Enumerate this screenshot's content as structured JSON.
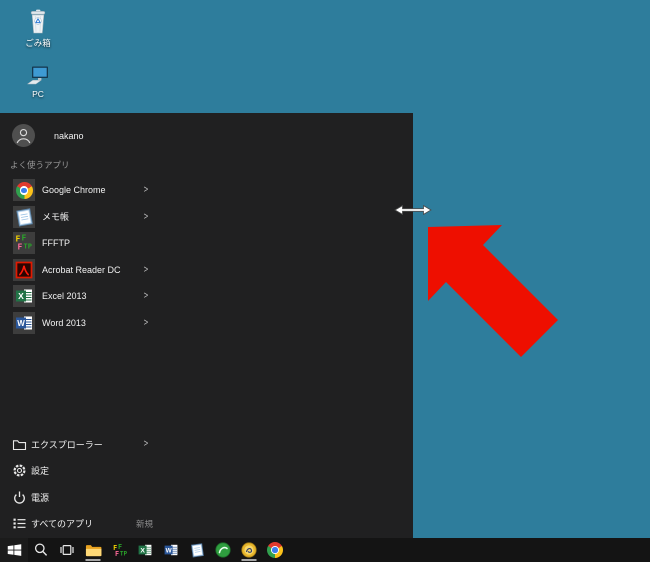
{
  "desktop": {
    "background_color": "#2e7d9c",
    "icons": [
      {
        "name": "recycle-bin",
        "label": "ごみ箱"
      },
      {
        "name": "pc",
        "label": "PC"
      }
    ]
  },
  "start_menu": {
    "user_name": "nakano",
    "section_header": "よく使うアプリ",
    "submenu_glyph": ">",
    "frequent_apps": [
      {
        "label": "Google Chrome",
        "icon": "chrome-icon",
        "has_submenu": true
      },
      {
        "label": "メモ帳",
        "icon": "notepad-icon",
        "has_submenu": true
      },
      {
        "label": "FFFTP",
        "icon": "ffftp-icon",
        "has_submenu": false
      },
      {
        "label": "Acrobat Reader DC",
        "icon": "acrobat-icon",
        "has_submenu": true
      },
      {
        "label": "Excel 2013",
        "icon": "excel-icon",
        "has_submenu": true
      },
      {
        "label": "Word 2013",
        "icon": "word-icon",
        "has_submenu": true
      }
    ],
    "system_items": [
      {
        "label": "エクスプローラー",
        "icon": "folder-outline-icon",
        "has_submenu": true,
        "badge": ""
      },
      {
        "label": "設定",
        "icon": "gear-icon",
        "has_submenu": false,
        "badge": ""
      },
      {
        "label": "電源",
        "icon": "power-icon",
        "has_submenu": false,
        "badge": ""
      },
      {
        "label": "すべてのアプリ",
        "icon": "all-apps-icon",
        "has_submenu": false,
        "badge": "新規"
      }
    ],
    "colors": {
      "menu_bg": "#202021",
      "tile_bg": "#3d3d3d"
    }
  },
  "annotation": {
    "type": "red-arrow-pointing-at-resize-cursor",
    "arrow_color": "#ee0f00",
    "cursor": "horizontal-resize"
  },
  "taskbar": {
    "background_color": "#141414",
    "buttons": [
      {
        "name": "start",
        "icon": "windows-logo-icon",
        "active": false
      },
      {
        "name": "search",
        "icon": "search-icon",
        "active": false
      },
      {
        "name": "task-view",
        "icon": "task-view-icon",
        "active": false
      },
      {
        "name": "file-explorer",
        "icon": "folder-icon",
        "active": true
      },
      {
        "name": "ffftp",
        "icon": "ffftp-icon",
        "active": false
      },
      {
        "name": "excel",
        "icon": "excel-icon",
        "active": false
      },
      {
        "name": "word",
        "icon": "word-icon",
        "active": false
      },
      {
        "name": "notepad",
        "icon": "notepad-icon",
        "active": false
      },
      {
        "name": "green-app",
        "icon": "green-circle-icon",
        "active": false
      },
      {
        "name": "gold-app",
        "icon": "gold-circle-icon",
        "active": true
      },
      {
        "name": "chrome",
        "icon": "chrome-icon",
        "active": false
      }
    ]
  }
}
